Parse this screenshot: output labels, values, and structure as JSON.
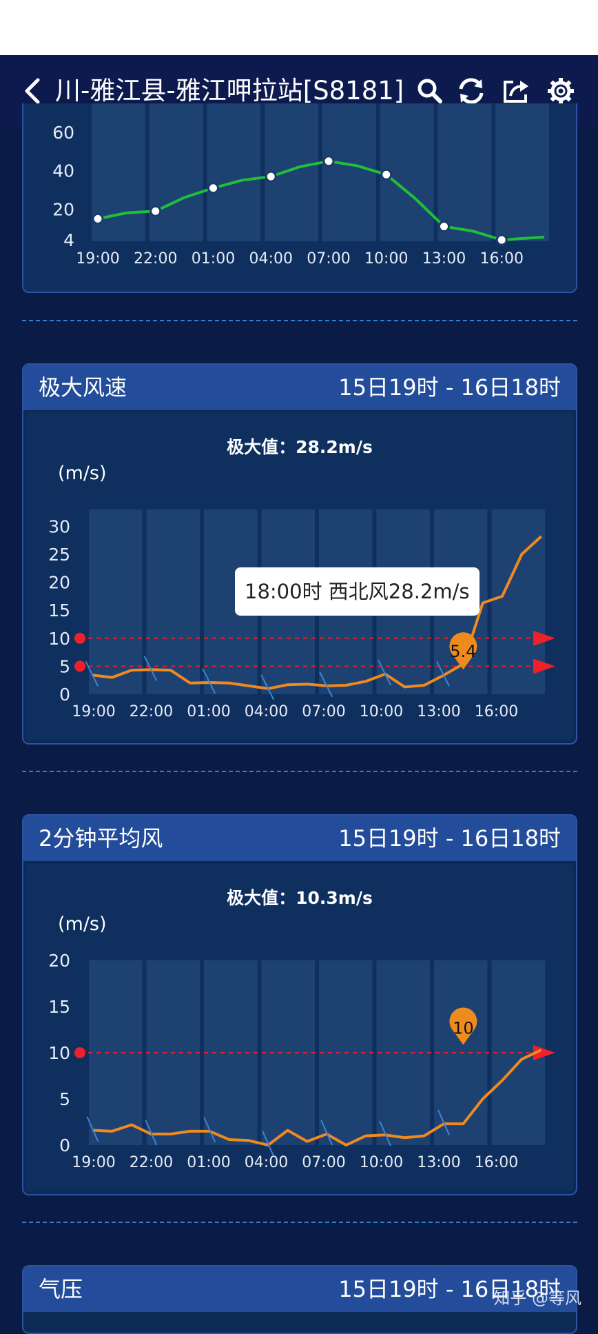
{
  "header": {
    "title": "川-雅江县-雅江呷拉站[S8181]",
    "icons": [
      "back-arrow-icon",
      "search-icon",
      "refresh-icon",
      "share-icon",
      "gear-icon"
    ]
  },
  "humidity_chart": {
    "chart_data": {
      "type": "line",
      "categories": [
        "19:00",
        "22:00",
        "01:00",
        "04:00",
        "07:00",
        "10:00",
        "13:00",
        "16:00"
      ],
      "y_ticks": [
        "60",
        "40",
        "20",
        "4"
      ],
      "series": [
        {
          "values": [
            15,
            19,
            31,
            37,
            45,
            38,
            11,
            4
          ]
        }
      ],
      "color": "#1fbf3a"
    }
  },
  "gust_panel": {
    "title": "极大风速",
    "range": "15日19时 - 16日18时",
    "max_label": "极大值：28.2m/s",
    "unit": "(m/s)",
    "tooltip": "18:00时 西北风28.2m/s",
    "marker_value": "5.4",
    "chart_data": {
      "type": "line",
      "categories": [
        "19:00",
        "22:00",
        "01:00",
        "04:00",
        "07:00",
        "10:00",
        "13:00",
        "16:00"
      ],
      "y_ticks": [
        "30",
        "25",
        "20",
        "15",
        "10",
        "5",
        "0"
      ],
      "ylim": [
        0,
        33
      ],
      "threshold_lines": [
        10,
        5
      ],
      "series": [
        {
          "values": [
            3.4,
            3.0,
            4.3,
            4.4,
            4.3,
            2.0,
            2.1,
            2.0,
            1.5,
            1.0,
            1.7,
            1.8,
            1.5,
            1.6,
            2.3,
            3.6,
            1.3,
            1.6,
            3.4,
            5.4,
            16.3,
            17.5,
            25.0,
            28.2
          ]
        }
      ],
      "color": "#f08a1e"
    }
  },
  "avg_panel": {
    "title": "2分钟平均风",
    "range": "15日19时 - 16日18时",
    "max_label": "极大值：10.3m/s",
    "unit": "(m/s)",
    "marker_value": "10",
    "chart_data": {
      "type": "line",
      "categories": [
        "19:00",
        "22:00",
        "01:00",
        "04:00",
        "07:00",
        "10:00",
        "13:00",
        "16:00"
      ],
      "y_ticks": [
        "20",
        "15",
        "10",
        "5",
        "0"
      ],
      "ylim": [
        0,
        20
      ],
      "threshold_lines": [
        10
      ],
      "series": [
        {
          "values": [
            1.6,
            1.5,
            2.2,
            1.2,
            1.2,
            1.5,
            1.5,
            0.6,
            0.5,
            0.0,
            1.6,
            0.4,
            1.2,
            0.0,
            1.0,
            1.1,
            0.8,
            1.0,
            2.3,
            2.3,
            5.0,
            7.0,
            9.3,
            10.3
          ]
        }
      ],
      "color": "#f08a1e"
    }
  },
  "pressure_panel": {
    "title": "气压",
    "range": "15日19时 - 16日18时"
  },
  "watermark": "知乎 @等风"
}
